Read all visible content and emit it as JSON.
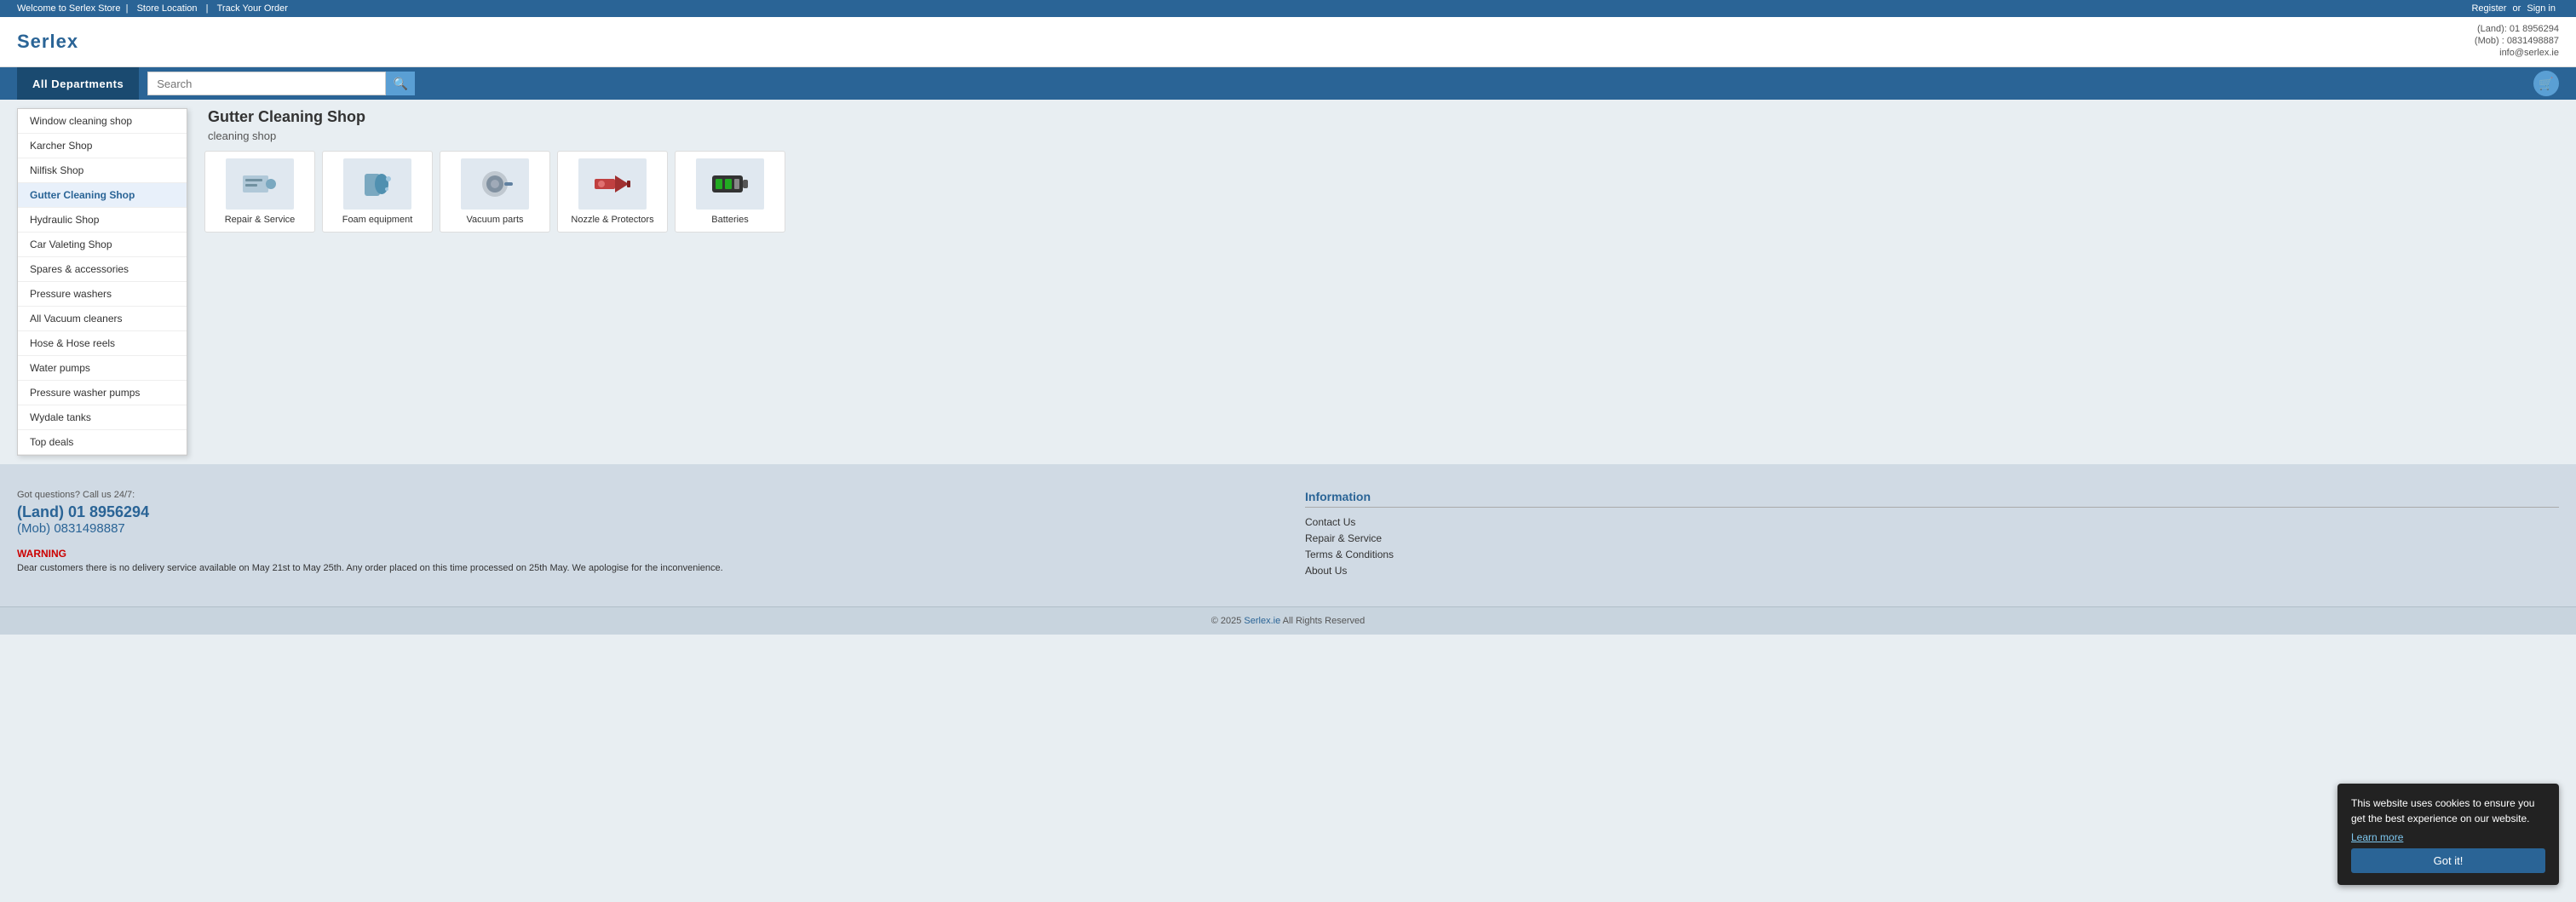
{
  "topbar": {
    "welcome": "Welcome to Serlex Store",
    "store_location": "Store Location",
    "track_order": "Track Your Order",
    "register": "Register",
    "or": "or",
    "sign_in": "Sign in"
  },
  "header": {
    "logo": "Serlex",
    "contact_land": "(Land): 01 8956294",
    "contact_mob": "(Mob) : 0831498887",
    "contact_email": "info@serlex.ie"
  },
  "navbar": {
    "all_departments": "All Departments",
    "search_placeholder": "Search"
  },
  "menu": {
    "items": [
      {
        "label": "Window cleaning shop",
        "active": false
      },
      {
        "label": "Karcher Shop",
        "active": false
      },
      {
        "label": "Nilfisk Shop",
        "active": false
      },
      {
        "label": "Gutter Cleaning Shop",
        "active": true
      },
      {
        "label": "Hydraulic Shop",
        "active": false
      },
      {
        "label": "Car Valeting Shop",
        "active": false
      },
      {
        "label": "Spares & accessories",
        "active": false
      },
      {
        "label": "Pressure washers",
        "active": false
      },
      {
        "label": "All Vacuum cleaners",
        "active": false
      },
      {
        "label": "Hose & Hose reels",
        "active": false
      },
      {
        "label": "Water pumps",
        "active": false
      },
      {
        "label": "Pressure washer pumps",
        "active": false
      },
      {
        "label": "Wydale tanks",
        "active": false
      },
      {
        "label": "Top deals",
        "active": false
      }
    ]
  },
  "gutter_shop": {
    "title": "Gutter Cleaning Shop",
    "subtitle": "cleaning shop",
    "categories": [
      {
        "label": "Repair & Service",
        "icon": "repair"
      },
      {
        "label": "Foam equipment",
        "icon": "foam"
      },
      {
        "label": "Vacuum parts",
        "icon": "vacuum"
      },
      {
        "label": "Nozzle & Protectors",
        "icon": "nozzle"
      },
      {
        "label": "Batteries",
        "icon": "battery"
      }
    ]
  },
  "footer": {
    "call_label": "Got questions? Call us 24/7:",
    "phone_land": "(Land) 01 8956294",
    "phone_mob": "(Mob) 0831498887",
    "warning_title": "WARNING",
    "warning_text": "Dear customers there is no delivery service available on May 21st to May 25th. Any order placed on this time processed on 25th May. We apologise for the inconvenience.",
    "info_title": "Information",
    "info_links": [
      "Contact Us",
      "Repair & Service",
      "Terms & Conditions",
      "About Us"
    ],
    "copyright": "© 2025 Serlex.ie All Rights Reserved",
    "serlex_link": "Serlex.ie"
  },
  "cookie": {
    "text": "This website uses cookies to ensure you get the best experience on our website.",
    "learn_more": "Learn more",
    "button": "Got it!"
  }
}
